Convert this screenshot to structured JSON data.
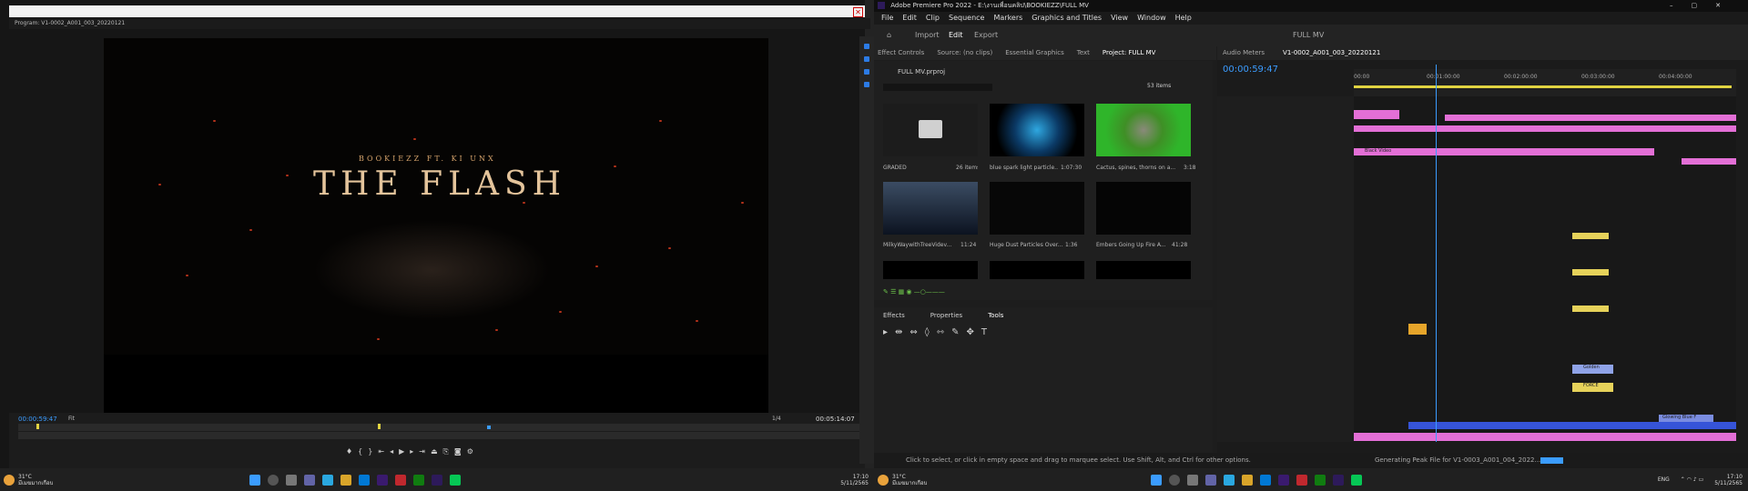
{
  "left": {
    "window_title": "Program: V1-0002_A001_003_20220121",
    "video_credit": "BOOKIEZZ FT. KI UNX",
    "video_title": "THE FLASH",
    "timecode": "00:00:59:47",
    "fit": "Fit",
    "fraction": "1/4",
    "duration": "00:05:14:07",
    "taskbar": {
      "temp": "31°C",
      "weather": "มีเมฆมากเกือบ",
      "time": "17:10",
      "date": "5/11/2565"
    }
  },
  "premiere": {
    "title": "Adobe Premiere Pro 2022 - E:\\งานเพื่อนคลิป\\BOOKIEZZ\\FULL MV",
    "menu": [
      "File",
      "Edit",
      "Clip",
      "Sequence",
      "Markers",
      "Graphics and Titles",
      "View",
      "Window",
      "Help"
    ],
    "workspace_tabs": {
      "import": "Import",
      "edit": "Edit",
      "export": "Export",
      "project_name": "FULL MV"
    },
    "panel_tabs": [
      "Effect Controls",
      "Source: (no clips)",
      "Essential Graphics",
      "Text",
      "Project: FULL MV"
    ],
    "project_file": "FULL MV.prproj",
    "item_count": "53 items",
    "bins": [
      {
        "name": "GRADED",
        "meta": "26 items"
      },
      {
        "name": "blue spark light particle...",
        "meta": "1:07:30"
      },
      {
        "name": "Cactus, spines, thorns on a...",
        "meta": "3:18"
      },
      {
        "name": "MilkyWaywithTreeVidev...",
        "meta": "11:24"
      },
      {
        "name": "Huge Dust Particles Over...",
        "meta": "1:36"
      },
      {
        "name": "Embers Going Up Fire A...",
        "meta": "41:28"
      }
    ],
    "lower_tabs": [
      "Effects",
      "Properties",
      "Tools"
    ],
    "timeline": {
      "tabs": [
        "Audio Meters",
        "V1-0002_A001_003_20220121"
      ],
      "timecode": "00:00:59:47",
      "ruler": [
        "00:00",
        "00:01:00:00",
        "00:02:00:00",
        "00:03:00:00",
        "00:04:00:00"
      ],
      "clip_labels": {
        "black_video": "Black Video",
        "golden": "Golden",
        "force": "FORCE",
        "cinematic": "Glowing Blue F"
      }
    },
    "status": "Click to select, or click in empty space and drag to marquee select. Use Shift, Alt, and Ctrl for other options.",
    "status_right": "Generating Peak File for V1-0003_A001_004_2022...",
    "taskbar": {
      "temp": "31°C",
      "weather": "มีเมฆมากเกือบ",
      "lang": "ENG",
      "time": "17:10",
      "date": "5/11/2565"
    }
  }
}
